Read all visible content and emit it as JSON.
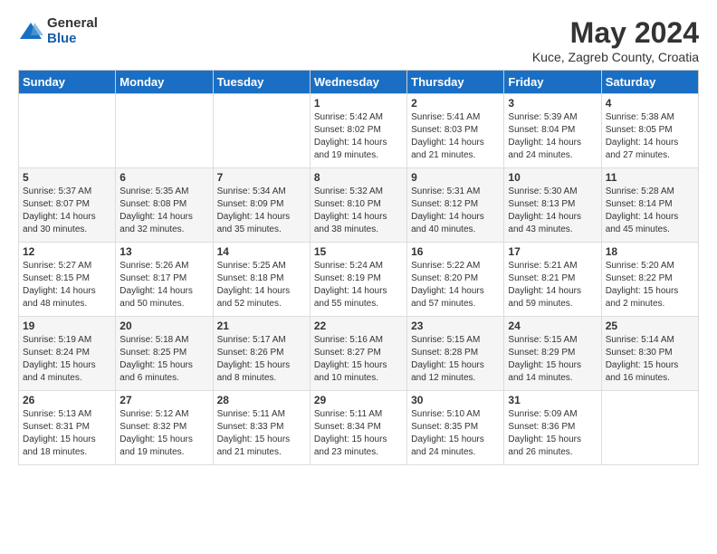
{
  "logo": {
    "general": "General",
    "blue": "Blue"
  },
  "title": "May 2024",
  "subtitle": "Kuce, Zagreb County, Croatia",
  "headers": [
    "Sunday",
    "Monday",
    "Tuesday",
    "Wednesday",
    "Thursday",
    "Friday",
    "Saturday"
  ],
  "weeks": [
    [
      {
        "day": "",
        "info": ""
      },
      {
        "day": "",
        "info": ""
      },
      {
        "day": "",
        "info": ""
      },
      {
        "day": "1",
        "info": "Sunrise: 5:42 AM\nSunset: 8:02 PM\nDaylight: 14 hours\nand 19 minutes."
      },
      {
        "day": "2",
        "info": "Sunrise: 5:41 AM\nSunset: 8:03 PM\nDaylight: 14 hours\nand 21 minutes."
      },
      {
        "day": "3",
        "info": "Sunrise: 5:39 AM\nSunset: 8:04 PM\nDaylight: 14 hours\nand 24 minutes."
      },
      {
        "day": "4",
        "info": "Sunrise: 5:38 AM\nSunset: 8:05 PM\nDaylight: 14 hours\nand 27 minutes."
      }
    ],
    [
      {
        "day": "5",
        "info": "Sunrise: 5:37 AM\nSunset: 8:07 PM\nDaylight: 14 hours\nand 30 minutes."
      },
      {
        "day": "6",
        "info": "Sunrise: 5:35 AM\nSunset: 8:08 PM\nDaylight: 14 hours\nand 32 minutes."
      },
      {
        "day": "7",
        "info": "Sunrise: 5:34 AM\nSunset: 8:09 PM\nDaylight: 14 hours\nand 35 minutes."
      },
      {
        "day": "8",
        "info": "Sunrise: 5:32 AM\nSunset: 8:10 PM\nDaylight: 14 hours\nand 38 minutes."
      },
      {
        "day": "9",
        "info": "Sunrise: 5:31 AM\nSunset: 8:12 PM\nDaylight: 14 hours\nand 40 minutes."
      },
      {
        "day": "10",
        "info": "Sunrise: 5:30 AM\nSunset: 8:13 PM\nDaylight: 14 hours\nand 43 minutes."
      },
      {
        "day": "11",
        "info": "Sunrise: 5:28 AM\nSunset: 8:14 PM\nDaylight: 14 hours\nand 45 minutes."
      }
    ],
    [
      {
        "day": "12",
        "info": "Sunrise: 5:27 AM\nSunset: 8:15 PM\nDaylight: 14 hours\nand 48 minutes."
      },
      {
        "day": "13",
        "info": "Sunrise: 5:26 AM\nSunset: 8:17 PM\nDaylight: 14 hours\nand 50 minutes."
      },
      {
        "day": "14",
        "info": "Sunrise: 5:25 AM\nSunset: 8:18 PM\nDaylight: 14 hours\nand 52 minutes."
      },
      {
        "day": "15",
        "info": "Sunrise: 5:24 AM\nSunset: 8:19 PM\nDaylight: 14 hours\nand 55 minutes."
      },
      {
        "day": "16",
        "info": "Sunrise: 5:22 AM\nSunset: 8:20 PM\nDaylight: 14 hours\nand 57 minutes."
      },
      {
        "day": "17",
        "info": "Sunrise: 5:21 AM\nSunset: 8:21 PM\nDaylight: 14 hours\nand 59 minutes."
      },
      {
        "day": "18",
        "info": "Sunrise: 5:20 AM\nSunset: 8:22 PM\nDaylight: 15 hours\nand 2 minutes."
      }
    ],
    [
      {
        "day": "19",
        "info": "Sunrise: 5:19 AM\nSunset: 8:24 PM\nDaylight: 15 hours\nand 4 minutes."
      },
      {
        "day": "20",
        "info": "Sunrise: 5:18 AM\nSunset: 8:25 PM\nDaylight: 15 hours\nand 6 minutes."
      },
      {
        "day": "21",
        "info": "Sunrise: 5:17 AM\nSunset: 8:26 PM\nDaylight: 15 hours\nand 8 minutes."
      },
      {
        "day": "22",
        "info": "Sunrise: 5:16 AM\nSunset: 8:27 PM\nDaylight: 15 hours\nand 10 minutes."
      },
      {
        "day": "23",
        "info": "Sunrise: 5:15 AM\nSunset: 8:28 PM\nDaylight: 15 hours\nand 12 minutes."
      },
      {
        "day": "24",
        "info": "Sunrise: 5:15 AM\nSunset: 8:29 PM\nDaylight: 15 hours\nand 14 minutes."
      },
      {
        "day": "25",
        "info": "Sunrise: 5:14 AM\nSunset: 8:30 PM\nDaylight: 15 hours\nand 16 minutes."
      }
    ],
    [
      {
        "day": "26",
        "info": "Sunrise: 5:13 AM\nSunset: 8:31 PM\nDaylight: 15 hours\nand 18 minutes."
      },
      {
        "day": "27",
        "info": "Sunrise: 5:12 AM\nSunset: 8:32 PM\nDaylight: 15 hours\nand 19 minutes."
      },
      {
        "day": "28",
        "info": "Sunrise: 5:11 AM\nSunset: 8:33 PM\nDaylight: 15 hours\nand 21 minutes."
      },
      {
        "day": "29",
        "info": "Sunrise: 5:11 AM\nSunset: 8:34 PM\nDaylight: 15 hours\nand 23 minutes."
      },
      {
        "day": "30",
        "info": "Sunrise: 5:10 AM\nSunset: 8:35 PM\nDaylight: 15 hours\nand 24 minutes."
      },
      {
        "day": "31",
        "info": "Sunrise: 5:09 AM\nSunset: 8:36 PM\nDaylight: 15 hours\nand 26 minutes."
      },
      {
        "day": "",
        "info": ""
      }
    ]
  ]
}
